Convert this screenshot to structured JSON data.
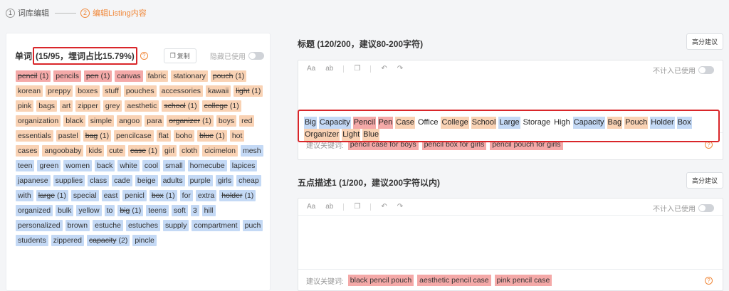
{
  "steps": [
    {
      "num": "1",
      "label": "词库编辑"
    },
    {
      "num": "2",
      "label": "编辑Listing内容"
    }
  ],
  "words_panel": {
    "title": "单词",
    "ratio": "(15/95，埋词占比15.79%)",
    "copy_label": "复制",
    "hide_used_label": "隐藏已使用",
    "tags": [
      {
        "text": "pencil",
        "count": "(1)",
        "color": "red",
        "used": true
      },
      {
        "text": "pencils",
        "count": "",
        "color": "red",
        "used": false
      },
      {
        "text": "pen",
        "count": "(1)",
        "color": "red",
        "used": true
      },
      {
        "text": "canvas",
        "count": "",
        "color": "red",
        "used": false
      },
      {
        "text": "fabric",
        "count": "",
        "color": "orange",
        "used": false
      },
      {
        "text": "stationary",
        "count": "",
        "color": "orange",
        "used": false
      },
      {
        "text": "pouch",
        "count": "(1)",
        "color": "orange",
        "used": true
      },
      {
        "text": "korean",
        "count": "",
        "color": "orange",
        "used": false
      },
      {
        "text": "preppy",
        "count": "",
        "color": "orange",
        "used": false
      },
      {
        "text": "boxes",
        "count": "",
        "color": "orange",
        "used": false
      },
      {
        "text": "stuff",
        "count": "",
        "color": "orange",
        "used": false
      },
      {
        "text": "pouches",
        "count": "",
        "color": "orange",
        "used": false
      },
      {
        "text": "accessories",
        "count": "",
        "color": "orange",
        "used": false
      },
      {
        "text": "kawaii",
        "count": "",
        "color": "orange",
        "used": false
      },
      {
        "text": "light",
        "count": "(1)",
        "color": "orange",
        "used": true
      },
      {
        "text": "pink",
        "count": "",
        "color": "orange",
        "used": false
      },
      {
        "text": "bags",
        "count": "",
        "color": "orange",
        "used": false
      },
      {
        "text": "art",
        "count": "",
        "color": "orange",
        "used": false
      },
      {
        "text": "zipper",
        "count": "",
        "color": "orange",
        "used": false
      },
      {
        "text": "grey",
        "count": "",
        "color": "orange",
        "used": false
      },
      {
        "text": "aesthetic",
        "count": "",
        "color": "orange",
        "used": false
      },
      {
        "text": "school",
        "count": "(1)",
        "color": "orange",
        "used": true
      },
      {
        "text": "college",
        "count": "(1)",
        "color": "orange",
        "used": true
      },
      {
        "text": "organization",
        "count": "",
        "color": "orange",
        "used": false
      },
      {
        "text": "black",
        "count": "",
        "color": "orange",
        "used": false
      },
      {
        "text": "simple",
        "count": "",
        "color": "orange",
        "used": false
      },
      {
        "text": "angoo",
        "count": "",
        "color": "orange",
        "used": false
      },
      {
        "text": "para",
        "count": "",
        "color": "orange",
        "used": false
      },
      {
        "text": "organizer",
        "count": "(1)",
        "color": "orange",
        "used": true
      },
      {
        "text": "boys",
        "count": "",
        "color": "orange",
        "used": false
      },
      {
        "text": "red",
        "count": "",
        "color": "orange",
        "used": false
      },
      {
        "text": "essentials",
        "count": "",
        "color": "orange",
        "used": false
      },
      {
        "text": "pastel",
        "count": "",
        "color": "orange",
        "used": false
      },
      {
        "text": "bag",
        "count": "(1)",
        "color": "orange",
        "used": true
      },
      {
        "text": "pencilcase",
        "count": "",
        "color": "orange",
        "used": false
      },
      {
        "text": "flat",
        "count": "",
        "color": "orange",
        "used": false
      },
      {
        "text": "boho",
        "count": "",
        "color": "orange",
        "used": false
      },
      {
        "text": "blue",
        "count": "(1)",
        "color": "orange",
        "used": true
      },
      {
        "text": "hot",
        "count": "",
        "color": "orange",
        "used": false
      },
      {
        "text": "cases",
        "count": "",
        "color": "orange",
        "used": false
      },
      {
        "text": "angoobaby",
        "count": "",
        "color": "orange",
        "used": false
      },
      {
        "text": "kids",
        "count": "",
        "color": "orange",
        "used": false
      },
      {
        "text": "cute",
        "count": "",
        "color": "orange",
        "used": false
      },
      {
        "text": "case",
        "count": "(1)",
        "color": "orange",
        "used": true
      },
      {
        "text": "girl",
        "count": "",
        "color": "orange",
        "used": false
      },
      {
        "text": "cloth",
        "count": "",
        "color": "orange",
        "used": false
      },
      {
        "text": "cicimelon",
        "count": "",
        "color": "orange",
        "used": false
      },
      {
        "text": "mesh",
        "count": "",
        "color": "blue",
        "used": false
      },
      {
        "text": "teen",
        "count": "",
        "color": "blue",
        "used": false
      },
      {
        "text": "green",
        "count": "",
        "color": "blue",
        "used": false
      },
      {
        "text": "women",
        "count": "",
        "color": "blue",
        "used": false
      },
      {
        "text": "back",
        "count": "",
        "color": "blue",
        "used": false
      },
      {
        "text": "white",
        "count": "",
        "color": "blue",
        "used": false
      },
      {
        "text": "cool",
        "count": "",
        "color": "blue",
        "used": false
      },
      {
        "text": "small",
        "count": "",
        "color": "blue",
        "used": false
      },
      {
        "text": "homecube",
        "count": "",
        "color": "blue",
        "used": false
      },
      {
        "text": "lapices",
        "count": "",
        "color": "blue",
        "used": false
      },
      {
        "text": "japanese",
        "count": "",
        "color": "blue",
        "used": false
      },
      {
        "text": "supplies",
        "count": "",
        "color": "blue",
        "used": false
      },
      {
        "text": "class",
        "count": "",
        "color": "blue",
        "used": false
      },
      {
        "text": "cade",
        "count": "",
        "color": "blue",
        "used": false
      },
      {
        "text": "beige",
        "count": "",
        "color": "blue",
        "used": false
      },
      {
        "text": "adults",
        "count": "",
        "color": "blue",
        "used": false
      },
      {
        "text": "purple",
        "count": "",
        "color": "blue",
        "used": false
      },
      {
        "text": "girls",
        "count": "",
        "color": "blue",
        "used": false
      },
      {
        "text": "cheap",
        "count": "",
        "color": "blue",
        "used": false
      },
      {
        "text": "with",
        "count": "",
        "color": "blue",
        "used": false
      },
      {
        "text": "large",
        "count": "(1)",
        "color": "blue",
        "used": true
      },
      {
        "text": "special",
        "count": "",
        "color": "blue",
        "used": false
      },
      {
        "text": "east",
        "count": "",
        "color": "blue",
        "used": false
      },
      {
        "text": "penicl",
        "count": "",
        "color": "blue",
        "used": false
      },
      {
        "text": "box",
        "count": "(1)",
        "color": "blue",
        "used": true
      },
      {
        "text": "for",
        "count": "",
        "color": "blue",
        "used": false
      },
      {
        "text": "extra",
        "count": "",
        "color": "blue",
        "used": false
      },
      {
        "text": "holder",
        "count": "(1)",
        "color": "blue",
        "used": true
      },
      {
        "text": "organized",
        "count": "",
        "color": "blue",
        "used": false
      },
      {
        "text": "bulk",
        "count": "",
        "color": "blue",
        "used": false
      },
      {
        "text": "yellow",
        "count": "",
        "color": "blue",
        "used": false
      },
      {
        "text": "to",
        "count": "",
        "color": "blue",
        "used": false
      },
      {
        "text": "big",
        "count": "(1)",
        "color": "blue",
        "used": true
      },
      {
        "text": "teens",
        "count": "",
        "color": "blue",
        "used": false
      },
      {
        "text": "soft",
        "count": "",
        "color": "blue",
        "used": false
      },
      {
        "text": "3",
        "count": "",
        "color": "blue",
        "used": false
      },
      {
        "text": "hill",
        "count": "",
        "color": "blue",
        "used": false
      },
      {
        "text": "personalized",
        "count": "",
        "color": "blue",
        "used": false
      },
      {
        "text": "brown",
        "count": "",
        "color": "blue",
        "used": false
      },
      {
        "text": "estuche",
        "count": "",
        "color": "blue",
        "used": false
      },
      {
        "text": "estuches",
        "count": "",
        "color": "blue",
        "used": false
      },
      {
        "text": "supply",
        "count": "",
        "color": "blue",
        "used": false
      },
      {
        "text": "compartment",
        "count": "",
        "color": "blue",
        "used": false
      },
      {
        "text": "puch",
        "count": "",
        "color": "blue",
        "used": false
      },
      {
        "text": "students",
        "count": "",
        "color": "blue",
        "used": false
      },
      {
        "text": "zippered",
        "count": "",
        "color": "blue",
        "used": false
      },
      {
        "text": "capacity",
        "count": "(2)",
        "color": "blue",
        "used": true
      },
      {
        "text": "pincle",
        "count": "",
        "color": "blue",
        "used": false
      }
    ]
  },
  "title_section": {
    "label": "标题 (120/200，建议80-200字符)",
    "suggest_button": "高分建议",
    "toolbar": {
      "aa": "Aa",
      "ab": "ab",
      "not_count": "不计入已使用"
    },
    "title_words": [
      {
        "text": "Big",
        "color": "blue"
      },
      {
        "text": "Capacity",
        "color": "blue"
      },
      {
        "text": "Pencil",
        "color": "red"
      },
      {
        "text": "Pen",
        "color": "red"
      },
      {
        "text": "Case",
        "color": "orange"
      },
      {
        "text": "Office",
        "color": "none"
      },
      {
        "text": "College",
        "color": "orange"
      },
      {
        "text": "School",
        "color": "orange"
      },
      {
        "text": "Large",
        "color": "blue"
      },
      {
        "text": "Storage",
        "color": "none"
      },
      {
        "text": "High",
        "color": "none"
      },
      {
        "text": "Capacity",
        "color": "blue"
      },
      {
        "text": "Bag",
        "color": "orange"
      },
      {
        "text": "Pouch",
        "color": "orange"
      },
      {
        "text": "Holder",
        "color": "blue"
      },
      {
        "text": "Box",
        "color": "blue"
      },
      {
        "text": "Organizer",
        "color": "orange"
      },
      {
        "text": "Light",
        "color": "orange"
      },
      {
        "text": "Blue",
        "color": "orange"
      }
    ],
    "keywords_label": "建议关键词:",
    "keywords": [
      "pencil case for boys",
      "pencil box for girls",
      "pencil pouch for girls"
    ]
  },
  "bullet_section": {
    "label": "五点描述1 (1/200，建议200字符以内)",
    "suggest_button": "高分建议",
    "toolbar": {
      "aa": "Aa",
      "ab": "ab",
      "not_count": "不计入已使用"
    },
    "keywords_label": "建议关键词:",
    "keywords": [
      "black pencil pouch",
      "aesthetic pencil case",
      "pink pencil case"
    ]
  },
  "colors": {
    "accent": "#f0883a",
    "highlight_border": "#d9262a",
    "tag_red": "#f4a9a8",
    "tag_orange": "#f9d2b4",
    "tag_blue": "#c4d9f5"
  }
}
